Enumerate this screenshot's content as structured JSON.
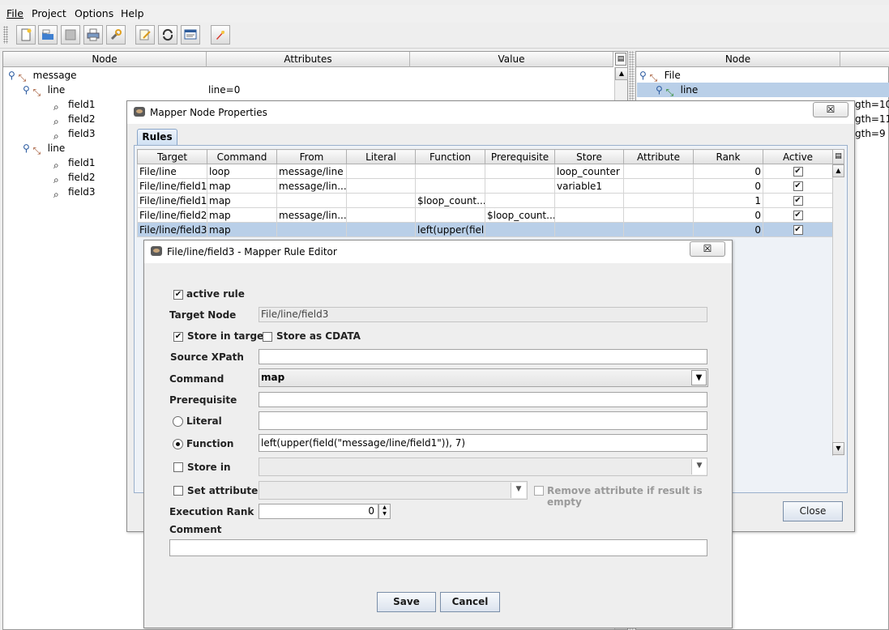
{
  "menubar": [
    "File",
    "Project",
    "Options",
    "Help"
  ],
  "toolbar": {
    "buttons": [
      "new-file-icon",
      "open-folder-icon",
      "save-icon",
      "print-icon",
      "wrench-icon",
      "edit-icon",
      "refresh-icon",
      "view-icon",
      "rocket-icon"
    ]
  },
  "left_panel": {
    "headers": [
      "Node",
      "Attributes",
      "Value"
    ],
    "rows": [
      {
        "name": "message",
        "attr": "",
        "value": ""
      },
      {
        "name": "line",
        "attr": "line=0",
        "value": ""
      },
      {
        "name": "field1",
        "attr": "",
        "value": ""
      },
      {
        "name": "field2",
        "attr": "",
        "value": ""
      },
      {
        "name": "field3",
        "attr": "",
        "value": ""
      },
      {
        "name": "line",
        "attr": "",
        "value": ""
      },
      {
        "name": "field1",
        "attr": "",
        "value": ""
      },
      {
        "name": "field2",
        "attr": "",
        "value": ""
      },
      {
        "name": "field3",
        "attr": "",
        "value": ""
      }
    ]
  },
  "right_panel": {
    "header": "Node",
    "rows": [
      "File",
      "line"
    ],
    "attr_fragments": [
      "gth=10",
      "gth=11",
      "gth=9"
    ]
  },
  "props_dialog": {
    "title": "Mapper Node Properties",
    "tab": "Rules",
    "columns": [
      "Target",
      "Command",
      "From",
      "Literal",
      "Function",
      "Prerequisite",
      "Store",
      "Attribute",
      "Rank",
      "Active"
    ],
    "rows": [
      {
        "target": "File/line",
        "command": "loop",
        "from": "message/line",
        "literal": "",
        "function": "",
        "prereq": "",
        "store": "loop_counter",
        "attribute": "",
        "rank": "0",
        "active": "✔"
      },
      {
        "target": "File/line/field1",
        "command": "map",
        "from": "message/lin...",
        "literal": "",
        "function": "",
        "prereq": "",
        "store": "variable1",
        "attribute": "",
        "rank": "0",
        "active": "✔"
      },
      {
        "target": "File/line/field1",
        "command": "map",
        "from": "",
        "literal": "",
        "function": "$loop_count...",
        "prereq": "",
        "store": "",
        "attribute": "",
        "rank": "1",
        "active": "✔"
      },
      {
        "target": "File/line/field2",
        "command": "map",
        "from": "message/lin...",
        "literal": "",
        "function": "",
        "prereq": "$loop_count...",
        "store": "",
        "attribute": "",
        "rank": "0",
        "active": "✔"
      },
      {
        "target": "File/line/field3",
        "command": "map",
        "from": "",
        "literal": "",
        "function": "left(upper(fiel...",
        "prereq": "",
        "store": "",
        "attribute": "",
        "rank": "0",
        "active": "✔"
      }
    ],
    "close_label": "Close"
  },
  "editor": {
    "title": "File/line/field3 - Mapper Rule Editor",
    "active_rule_label": "active rule",
    "active_rule_checked": "✔",
    "target_node_label": "Target Node",
    "target_node_value": "File/line/field3",
    "store_in_target_label": "Store in target",
    "store_in_target_checked": "✔",
    "store_as_cdata_label": "Store as CDATA",
    "source_xpath_label": "Source XPath",
    "source_xpath_value": "",
    "command_label": "Command",
    "command_value": "map",
    "prerequisite_label": "Prerequisite",
    "prerequisite_value": "",
    "literal_label": "Literal",
    "literal_value": "",
    "function_label": "Function",
    "function_value": "left(upper(field(\"message/line/field1\")), 7)",
    "store_in_label": "Store in",
    "set_attribute_label": "Set attribute",
    "remove_attr_label": "Remove attribute if result is empty",
    "execution_rank_label": "Execution Rank",
    "execution_rank_value": "0",
    "comment_label": "Comment",
    "comment_value": "",
    "save_label": "Save",
    "cancel_label": "Cancel"
  },
  "colors": {
    "selection": "#b9cfe8",
    "accent_button": "#dbe3ee",
    "window_bg": "#eeeeee"
  }
}
